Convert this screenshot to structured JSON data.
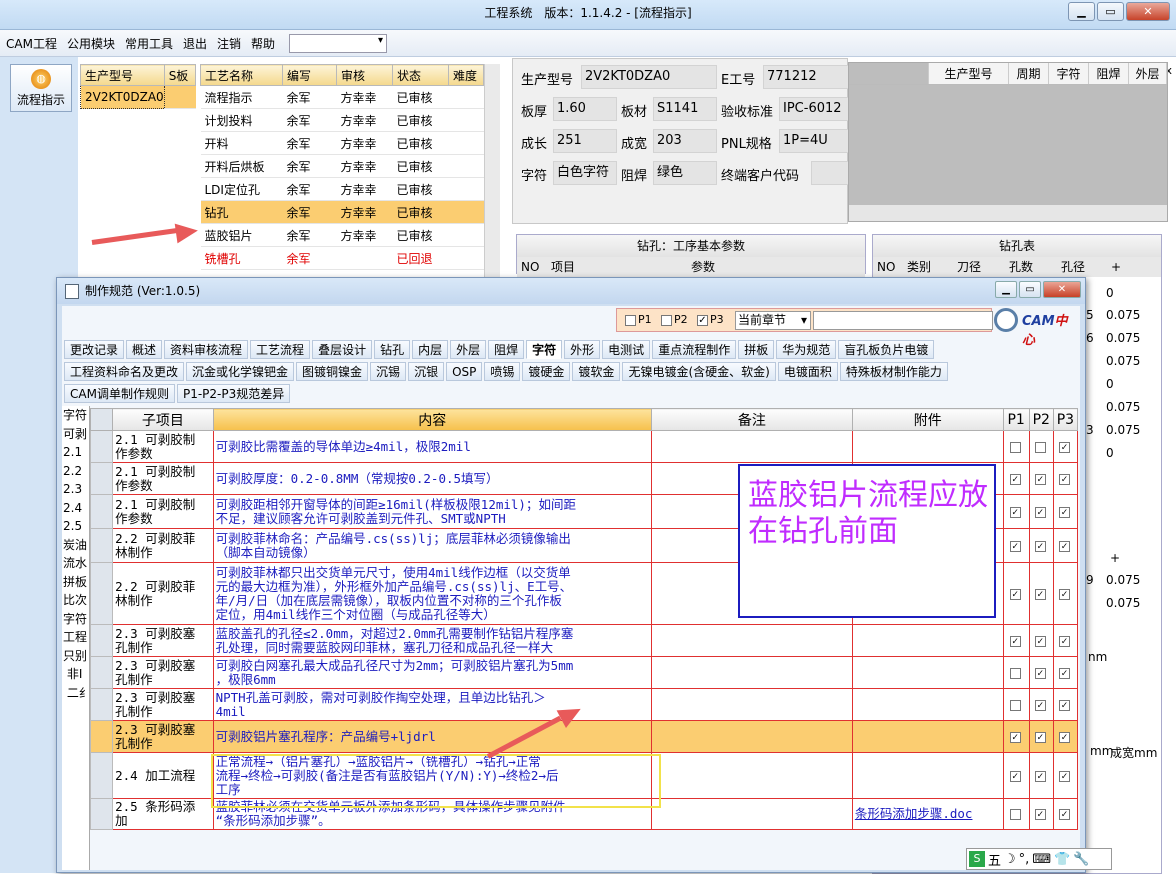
{
  "app": {
    "title": "工程系统　版本：1.1.4.2 - [流程指示]",
    "menu": [
      "CAM工程",
      "公用模块",
      "常用工具",
      "退出",
      "注销",
      "帮助"
    ],
    "mdi_controls": [
      "-",
      "▭",
      "x"
    ],
    "side_button": "流程指示"
  },
  "product_grid": {
    "headers": [
      "生产型号",
      "S板"
    ],
    "rows": [
      [
        "2V2KT0DZA0",
        ""
      ]
    ]
  },
  "process_grid": {
    "headers": [
      "工艺名称",
      "编写",
      "审核",
      "状态",
      "难度"
    ],
    "rows": [
      [
        "流程指示",
        "余军",
        "方幸幸",
        "已审核",
        ""
      ],
      [
        "计划投料",
        "余军",
        "方幸幸",
        "已审核",
        ""
      ],
      [
        "开料",
        "余军",
        "方幸幸",
        "已审核",
        ""
      ],
      [
        "开料后烘板",
        "余军",
        "方幸幸",
        "已审核",
        ""
      ],
      [
        "LDI定位孔",
        "余军",
        "方幸幸",
        "已审核",
        ""
      ],
      [
        "钻孔",
        "余军",
        "方幸幸",
        "已审核",
        ""
      ],
      [
        "蓝胶铝片",
        "余军",
        "方幸幸",
        "已审核",
        ""
      ],
      [
        "铣槽孔",
        "余军",
        "",
        "已回退",
        ""
      ],
      [
        "",
        "",
        "",
        "",
        ""
      ]
    ]
  },
  "info": {
    "prod_label": "生产型号",
    "prod_value": "2V2KT0DZA0",
    "e_label": "E工号",
    "e_value": "771212",
    "thick_label": "板厚",
    "thick_value": "1.60",
    "mat_label": "板材",
    "mat_value": "S1141",
    "std_label": "验收标准",
    "std_value": "IPC-6012",
    "len_label": "成长",
    "len_value": "251",
    "wid_label": "成宽",
    "wid_value": "203",
    "pnl_label": "PNL规格",
    "pnl_value": "1P=4U",
    "char_label": "字符",
    "char_value": "白色字符",
    "mask_label": "阻焊",
    "mask_value": "绿色",
    "cust_label": "终端客户代码",
    "cust_value": ""
  },
  "right_grid": {
    "headers": [
      "生产型号",
      "周期",
      "字符",
      "阻焊",
      "外层"
    ]
  },
  "drill_params": {
    "caption": "钻孔：工序基本参数",
    "headers": [
      "NO",
      "项目",
      "参数"
    ]
  },
  "drill_table": {
    "caption": "钻孔表",
    "headers": [
      "NO",
      "类别",
      "刀径",
      "孔数",
      "孔径",
      "+"
    ],
    "values": [
      "0",
      "0.075",
      "0.075",
      "0.075",
      "0",
      "0.075",
      "0.075",
      "0"
    ],
    "partials": [
      "5",
      "6",
      "3"
    ],
    "lower_values": [
      "+",
      "0.075",
      "0.075"
    ],
    "lower_partial": "9",
    "mm_label": "mm",
    "mm2": "nm",
    "final_label": "成宽mm"
  },
  "dialog": {
    "title": "制作规范 (Ver:1.0.5)",
    "filters": [
      "P1",
      "P2",
      "P3"
    ],
    "filter_checked": [
      false,
      false,
      true
    ],
    "chapter": "当前章节",
    "logo_a": "CAM",
    "logo_b": "中心",
    "tabs_row1": [
      "更改记录",
      "概述",
      "资料审核流程",
      "工艺流程",
      "叠层设计",
      "钻孔",
      "内层",
      "外层",
      "阻焊",
      "字符",
      "外形",
      "电测试",
      "重点流程制作",
      "拼板",
      "华为规范",
      "盲孔板负片电镀"
    ],
    "active_tab": "字符",
    "tabs_row2": [
      "工程资料命名及更改",
      "沉金或化学镍钯金",
      "图镀铜镍金",
      "沉锡",
      "沉银",
      "OSP",
      "喷锡",
      "镀硬金",
      "镀软金",
      "无镍电镀金(含硬金、软金)",
      "电镀面积",
      "特殊板材制作能力"
    ],
    "tabs_row3": [
      "CAM调单制作规则",
      "P1-P2-P3规范差异"
    ],
    "side_text": "字符\n可剥\n2.1\n2.2\n2.3\n2.4\n2.5\n炭油\n流水\n拼板\n比次\n字符\n工程\n只别\n 非I\n 二纟",
    "grid_headers": [
      "子项目",
      "内容",
      "备注",
      "附件",
      "P1",
      "P2",
      "P3"
    ],
    "rows": [
      {
        "sub": "2.1 可剥胶制\n作参数",
        "content": "可剥胶比需覆盖的导体单边≥4mil，极限2mil",
        "note": "",
        "att": "",
        "p": [
          false,
          false,
          true
        ]
      },
      {
        "sub": "2.1 可剥胶制\n作参数",
        "content": "可剥胶厚度：0.2-0.8MM（常规按0.2-0.5填写）",
        "note": "",
        "att": "",
        "p": [
          true,
          true,
          true
        ]
      },
      {
        "sub": "2.1 可剥胶制\n作参数",
        "content": "可剥胶距相邻开窗导体的间距≥16mil(样板极限12mil)；如间距\n不足，建议顾客允许可剥胶盖到元件孔、SMT或NPTH",
        "note": "",
        "att": "",
        "p": [
          true,
          true,
          true
        ]
      },
      {
        "sub": "2.2 可剥胶菲\n林制作",
        "content": "可剥胶菲林命名：产品编号.cs(ss)lj；底层菲林必须镜像输出\n（脚本自动镜像）",
        "note": "",
        "att": "",
        "p": [
          true,
          true,
          true
        ]
      },
      {
        "sub": "2.2 可剥胶菲\n林制作",
        "content": "可剥胶菲林都只出交货单元尺寸，使用4mil线作边框（以交货单\n元的最大边框为准），外形框外加产品编号.cs(ss)lj、E工号、\n年/月/日（加在底层需镜像），取板内位置不对称的三个孔作板\n定位，用4mil线作三个对位圈（与成品孔径等大）",
        "note": "",
        "att": "",
        "p": [
          true,
          true,
          true
        ]
      },
      {
        "sub": "2.3 可剥胶塞\n孔制作",
        "content": "蓝胶盖孔的孔径≤2.0mm，对超过2.0mm孔需要制作钻铝片程序塞\n孔处理，同时需要蓝胶网印菲林，塞孔刀径和成品孔径一样大",
        "note": "",
        "att": "",
        "p": [
          true,
          true,
          true
        ]
      },
      {
        "sub": "2.3 可剥胶塞\n孔制作",
        "content": "可剥胶白网塞孔最大成品孔径尺寸为2mm；可剥胶铝片塞孔为5mm\n，极限6mm",
        "note": "",
        "att": "",
        "p": [
          false,
          true,
          true
        ]
      },
      {
        "sub": "2.3 可剥胶塞\n孔制作",
        "content": "NPTH孔盖可剥胶，需对可剥胶作掏空处理，且单边比钻孔＞\n4mil",
        "note": "",
        "att": "",
        "p": [
          false,
          true,
          true
        ]
      },
      {
        "sub": "2.3 可剥胶塞\n孔制作",
        "content": "可剥胶铝片塞孔程序：产品编号+ljdrl",
        "note": "",
        "att": "",
        "p": [
          true,
          true,
          true
        ],
        "hl": true
      },
      {
        "sub": "2.4 加工流程",
        "content": "正常流程→（铝片塞孔）→蓝胶铝片→（铣槽孔）→钻孔→正常\n流程→终检→可剥胶(备注是否有蓝胶铝片(Y/N):Y)→终检2→后\n工序",
        "note": "",
        "att": "",
        "p": [
          true,
          true,
          true
        ]
      },
      {
        "sub": "2.5 条形码添\n加",
        "content": "蓝胶菲林必须在交货单元板外添加条形码，具体操作步骤见附件\n“条形码添加步骤”。",
        "note": "",
        "att": "条形码添加步骤.doc",
        "p": [
          false,
          true,
          true
        ]
      }
    ]
  },
  "annotation": {
    "text": "蓝胶铝片流程应放在钻孔前面",
    "color": "#c02cff",
    "border": "#1c1cbf"
  },
  "ime": {
    "label": "五",
    "glyphs": [
      "☽",
      "°,",
      "⌨",
      "👕",
      "🔧"
    ]
  }
}
